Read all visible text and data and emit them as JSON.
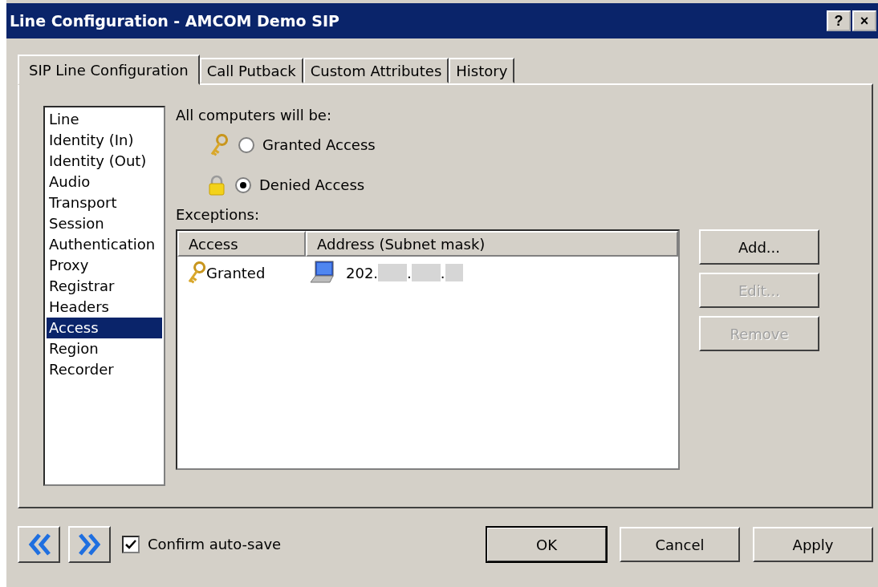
{
  "window": {
    "title": "Line Configuration - AMCOM Demo SIP",
    "controls": [
      "?",
      "×"
    ]
  },
  "tabs": [
    {
      "label": "SIP Line Configuration",
      "selected": true
    },
    {
      "label": "Call Putback",
      "selected": false
    },
    {
      "label": "Custom Attributes",
      "selected": false
    },
    {
      "label": "History",
      "selected": false
    }
  ],
  "sidebar": {
    "items": [
      {
        "label": "Line",
        "selected": false
      },
      {
        "label": "Identity (In)",
        "selected": false
      },
      {
        "label": "Identity (Out)",
        "selected": false
      },
      {
        "label": "Audio",
        "selected": false
      },
      {
        "label": "Transport",
        "selected": false
      },
      {
        "label": "Session",
        "selected": false
      },
      {
        "label": "Authentication",
        "selected": false
      },
      {
        "label": "Proxy",
        "selected": false
      },
      {
        "label": "Registrar",
        "selected": false
      },
      {
        "label": "Headers",
        "selected": false
      },
      {
        "label": "Access",
        "selected": true
      },
      {
        "label": "Region",
        "selected": false
      },
      {
        "label": "Recorder",
        "selected": false
      }
    ]
  },
  "default_access": {
    "label": "All computers will be:",
    "options": [
      {
        "label": "Granted Access",
        "kind": "key",
        "selected": false
      },
      {
        "label": "Denied Access",
        "kind": "lock",
        "selected": true
      }
    ]
  },
  "exceptions": {
    "label": "Exceptions:",
    "columns": [
      "Access",
      "Address (Subnet mask)"
    ],
    "rows": [
      {
        "access": "Granted",
        "kind": "key",
        "address": [
          "202.",
          ".",
          "."
        ]
      }
    ]
  },
  "side_buttons": [
    {
      "label": "Add...",
      "disabled": false
    },
    {
      "label": "Edit...",
      "disabled": true
    },
    {
      "label": "Remove",
      "disabled": true
    }
  ],
  "footer": {
    "confirm": {
      "label": "Confirm auto-save",
      "checked": true
    },
    "buttons": [
      {
        "label": "OK",
        "default": true
      },
      {
        "label": "Cancel",
        "default": false
      },
      {
        "label": "Apply",
        "default": false
      }
    ]
  }
}
